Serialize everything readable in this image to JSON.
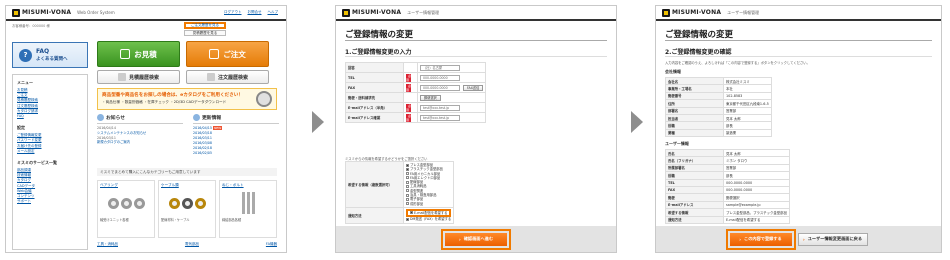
{
  "screen1": {
    "logo": "MISUMI-VONA",
    "subtitle": "Web Order System",
    "header_note": "お客様番号：000000 様",
    "header_links": [
      "ログアウト",
      "お問合せ",
      "ヘルプ"
    ],
    "order_history_button": "ご注文履歴を見る",
    "order_history_button_2": "見積履歴を見る",
    "faq": {
      "icon": "?",
      "line1": "FAQ",
      "line2": "よくある質問へ"
    },
    "quote_button": "お見積",
    "order_button": "ご注文",
    "quote_history_button": "見積履歴検索",
    "order_history_search_button": "注文履歴検索",
    "menu": {
      "title": "メニュー",
      "items": [
        "お見積",
        "ご注文",
        "見積履歴検索",
        "注文履歴検索",
        "カタログ請求",
        "FAQ"
      ],
      "settings_title": "設定",
      "settings_items": [
        "ご登録情報変更",
        "パスワード変更",
        "お届け先の登録",
        "メール設定"
      ],
      "services_title": "ミスミのサービス一覧",
      "service_items": [
        "部品調達",
        "技術情報",
        "カタログ",
        "CADデータ",
        "Web会議",
        "コンテンツ",
        "サポート"
      ]
    },
    "banner": {
      "line1": "商品型番や商品名をお探しの場合は、eカタログをご利用ください！",
      "line2": "・商品仕様  ・数量別価格  ・在庫チェック  ・2D/3D CADデータダウンロード"
    },
    "news": {
      "title": "お知らせ",
      "items": [
        "2016/04/14",
        "システムメンテナンスのお知らせ",
        "2016/03/11",
        "新規カタログのご案内"
      ]
    },
    "updates": {
      "title": "更新情報",
      "new_badge": "NEW",
      "items": [
        "2016/04/15",
        "2016/03/18",
        "2016/03/11",
        "2016/03/08",
        "2016/02/18",
        "2016/02/05"
      ]
    },
    "category_bar": "ミスミでまとめて購入にこんなカテゴリーもご用意しています",
    "products": [
      {
        "title": "ベアリング",
        "desc": "軸受けユニット各種"
      },
      {
        "title": "ケーブル類",
        "desc": "配線材料・ケーブル"
      },
      {
        "title": "ねじ・ボルト",
        "desc": "締結部品各種"
      }
    ],
    "product_links": [
      "工具・消耗品",
      "電気部品",
      "FA機器"
    ]
  },
  "screen2": {
    "logo": "MISUMI-VONA",
    "header_label": "ユーザー情報管理",
    "title": "ご登録情報の変更",
    "step": "1.ご登録情報変更の入力",
    "form_a": [
      {
        "label": "回答",
        "required": false,
        "value": "（社）名古屋"
      },
      {
        "label": "TEL",
        "required": true,
        "value": "000-0000-0000"
      },
      {
        "label": "FAX",
        "required": true,
        "value": "000-0000-0000",
        "button": "FAX送信"
      },
      {
        "label": "郵便・送料請求先",
        "required": false,
        "value": "",
        "button": "郵便選択"
      },
      {
        "label": "E-mailアドレス（半角）",
        "required": true,
        "value": "test@xxx.test.jp"
      },
      {
        "label": "E-mailアドレス確認",
        "required": true,
        "value": "test@xxx.test.jp"
      }
    ],
    "required_badge": "必須",
    "note": "ミスミからの情報を希望するかどうかをご選択ください",
    "form_b_label1": "希望する情報（複数選択可）",
    "form_b_options": [
      "プレス金型部品",
      "プラスチック金型部品",
      "FA用メカニカル部品",
      "FA用エレクトロ部品",
      "配線部品",
      "工具消耗品",
      "金型関連",
      "治具・検査用部品",
      "電子部品",
      "成形部品"
    ],
    "form_b_label2": "通知方法",
    "notify_options": [
      "E-mail配信を希望する",
      "DM発送（FAX）を希望する"
    ],
    "highlight_option": "E-mail配信を希望する",
    "confirm_button": "確認画面へ進む"
  },
  "screen3": {
    "logo": "MISUMI-VONA",
    "header_label": "ユーザー情報管理",
    "title": "ご登録情報の変更",
    "step": "2.ご登録情報変更の確認",
    "note": "入力内容をご確認のうえ、よろしければ「この内容で登録する」ボタンをクリックしてください。",
    "section_company": "会社情報",
    "company_rows": [
      {
        "label": "会社名",
        "value": "株式会社ミスミ"
      },
      {
        "label": "事業所・工場名",
        "value": "本社"
      },
      {
        "label": "郵便番号",
        "value": "102-8583"
      },
      {
        "label": "住所",
        "value": "東京都千代田区九段南1-6-5"
      },
      {
        "label": "部署名",
        "value": "営業部"
      },
      {
        "label": "担当者",
        "value": "見本 太郎"
      },
      {
        "label": "役職",
        "value": "部長"
      },
      {
        "label": "業種",
        "value": "製造業"
      }
    ],
    "section_user": "ユーザー情報",
    "user_rows": [
      {
        "label": "氏名",
        "value": "見本 太郎"
      },
      {
        "label": "氏名（フリガナ）",
        "value": "ミホン タロウ"
      },
      {
        "label": "所属部署名",
        "value": "営業部"
      },
      {
        "label": "役職",
        "value": "部長"
      },
      {
        "label": "TEL",
        "value": "000-0000-0000"
      },
      {
        "label": "FAX",
        "value": "000-0000-0000"
      },
      {
        "label": "郵便",
        "value": "郵便選択"
      },
      {
        "label": "E-mailアドレス",
        "value": "sample@example.jp"
      },
      {
        "label": "希望する情報",
        "value": "プレス金型部品、プラスチック金型部品"
      },
      {
        "label": "通知方法",
        "value": "E-mail配信を希望する"
      }
    ],
    "confirm_button": "この内容で登録する",
    "back_button": "ユーザー情報変更画面に戻る"
  }
}
